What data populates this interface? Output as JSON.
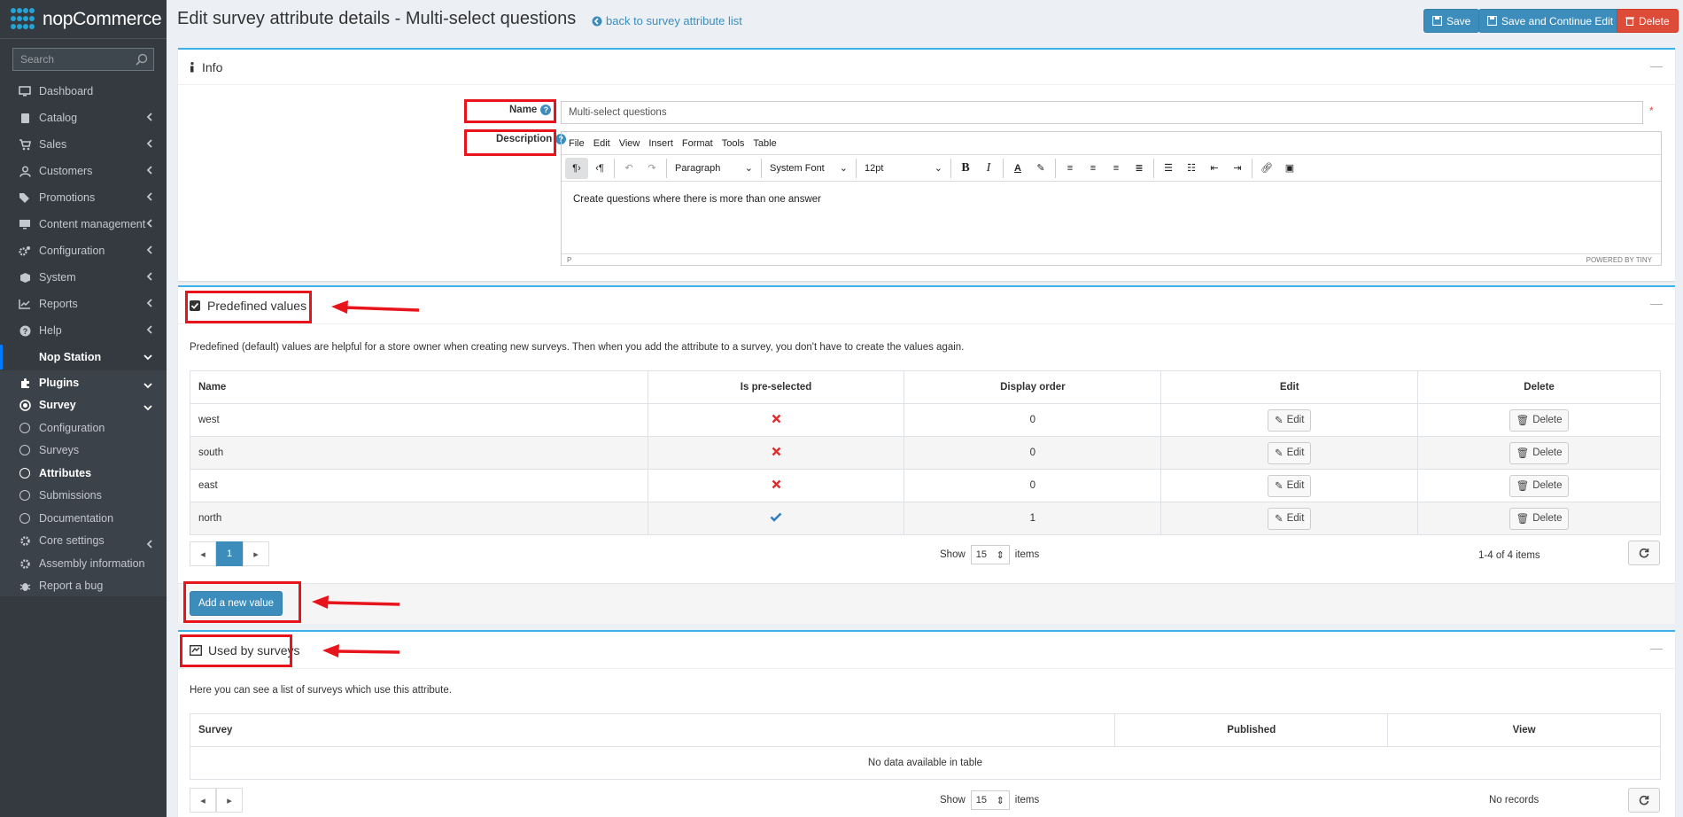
{
  "brand": {
    "name": "nopCommerce"
  },
  "sidebar": {
    "search_placeholder": "Search",
    "items": [
      {
        "label": "Dashboard",
        "icon": "monitor-icon"
      },
      {
        "label": "Catalog",
        "icon": "book-icon"
      },
      {
        "label": "Sales",
        "icon": "cart-icon"
      },
      {
        "label": "Customers",
        "icon": "user-icon"
      },
      {
        "label": "Promotions",
        "icon": "tags-icon"
      },
      {
        "label": "Content management",
        "icon": "desktop-icon"
      },
      {
        "label": "Configuration",
        "icon": "gears-icon"
      },
      {
        "label": "System",
        "icon": "cube-icon"
      },
      {
        "label": "Reports",
        "icon": "line-chart-icon"
      },
      {
        "label": "Help",
        "icon": "question-circle-icon"
      },
      {
        "label": "Nop Station",
        "icon": "circle-icon"
      },
      {
        "label": "Plugins",
        "icon": "puzzle-icon"
      },
      {
        "label": "Survey",
        "icon": "dot-circle-icon"
      },
      {
        "label": "Configuration",
        "icon": "circle-outline-icon"
      },
      {
        "label": "Surveys",
        "icon": "circle-outline-icon"
      },
      {
        "label": "Attributes",
        "icon": "circle-outline-icon"
      },
      {
        "label": "Submissions",
        "icon": "circle-outline-icon"
      },
      {
        "label": "Documentation",
        "icon": "circle-outline-icon"
      },
      {
        "label": "Core settings",
        "icon": "gear-icon"
      },
      {
        "label": "Assembly information",
        "icon": "gear-icon"
      },
      {
        "label": "Report a bug",
        "icon": "bug-icon"
      }
    ]
  },
  "header": {
    "title": "Edit survey attribute details - Multi-select questions",
    "back_link": "back to survey attribute list",
    "save": "Save",
    "save_continue": "Save and Continue Edit",
    "delete": "Delete"
  },
  "info": {
    "title": "Info",
    "name_label": "Name",
    "name_value": "Multi-select questions",
    "description_label": "Description",
    "editor_menu": [
      "File",
      "Edit",
      "View",
      "Insert",
      "Format",
      "Tools",
      "Table"
    ],
    "block_format": "Paragraph",
    "font_family": "System Font",
    "font_size": "12pt",
    "description_text": "Create questions where there is more than one answer",
    "status_path": "P",
    "powered_by": "POWERED BY TINY"
  },
  "predefined": {
    "title": "Predefined values",
    "hint": "Predefined (default) values are helpful for a store owner when creating new surveys. Then when you add the attribute to a survey, you don't have to create the values again.",
    "columns": [
      "Name",
      "Is pre-selected",
      "Display order",
      "Edit",
      "Delete"
    ],
    "rows": [
      {
        "name": "west",
        "preselected": false,
        "order": "0"
      },
      {
        "name": "south",
        "preselected": false,
        "order": "0"
      },
      {
        "name": "east",
        "preselected": false,
        "order": "0"
      },
      {
        "name": "north",
        "preselected": true,
        "order": "1"
      }
    ],
    "edit_label": "Edit",
    "delete_label": "Delete",
    "page": "1",
    "show_label": "Show",
    "page_size": "15",
    "items_label": "items",
    "count": "1-4 of 4 items",
    "add_button": "Add a new value"
  },
  "used_by": {
    "title": "Used by surveys",
    "hint": "Here you can see a list of surveys which use this attribute.",
    "columns": [
      "Survey",
      "Published",
      "View"
    ],
    "empty": "No data available in table",
    "show_label": "Show",
    "page_size": "15",
    "items_label": "items",
    "count": "No records"
  },
  "colors": {
    "accent": "#3c8dbc",
    "danger": "#dd4b39",
    "sidebar": "#343a40",
    "annotation": "#e8141c"
  }
}
